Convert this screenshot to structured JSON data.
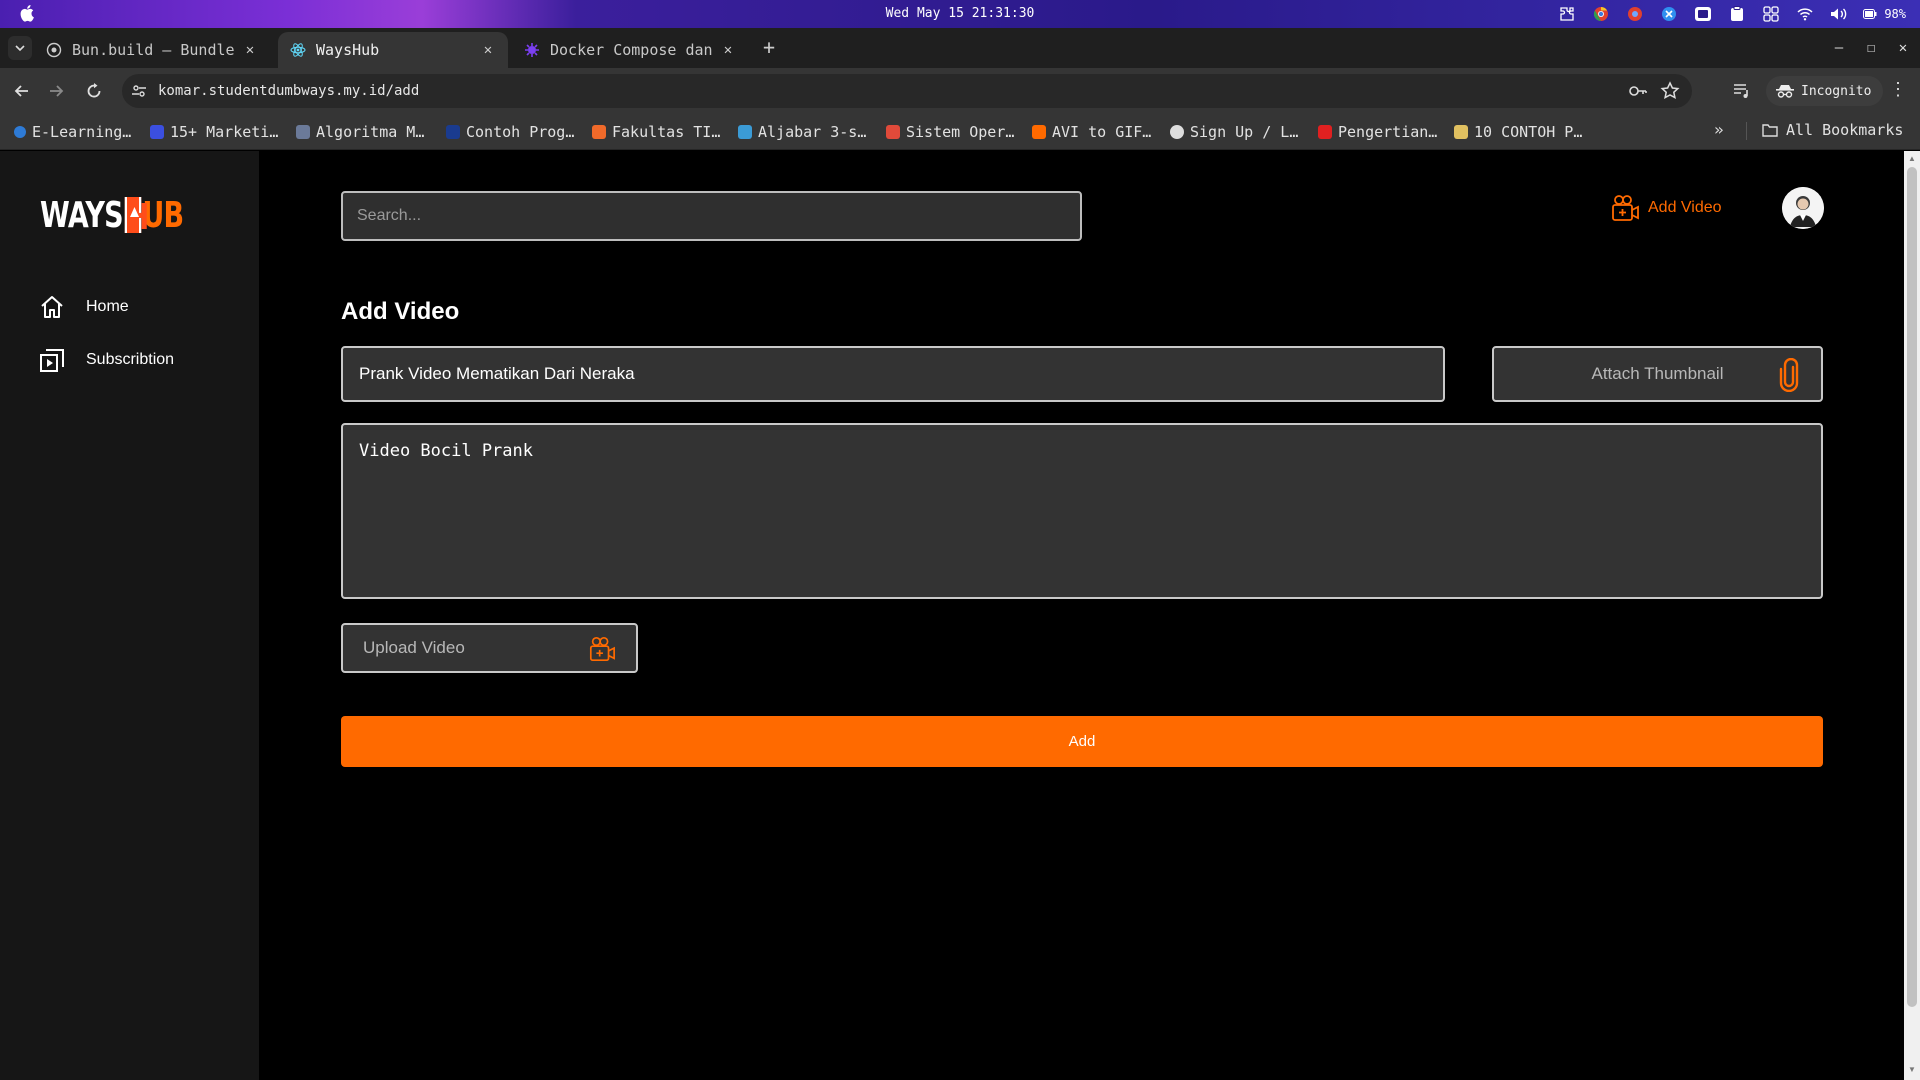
{
  "menubar": {
    "clock": "Wed May 15 21:31:30",
    "battery": "98%"
  },
  "tabs": [
    {
      "title": "Bun.build – Bundler",
      "active": false
    },
    {
      "title": "WaysHub",
      "active": true
    },
    {
      "title": "Docker Compose dan",
      "active": false
    }
  ],
  "toolbar": {
    "url": "komar.studentdumbways.my.id/add",
    "incognito_label": "Incognito"
  },
  "bookmarks": {
    "items": [
      {
        "label": "E-Learning…",
        "color": "#2e7bd6"
      },
      {
        "label": "15+ Marketi…",
        "color": "#3b4fe0"
      },
      {
        "label": "Algoritma M…",
        "color": "#6b7a99"
      },
      {
        "label": "Contoh Prog…",
        "color": "#1a3b8f"
      },
      {
        "label": "Fakultas TI…",
        "color": "#f06a2a"
      },
      {
        "label": "Aljabar 3-s…",
        "color": "#3b9bd6"
      },
      {
        "label": "Sistem Oper…",
        "color": "#e04a3a"
      },
      {
        "label": "AVI to GIF…",
        "color": "#ff6a00"
      },
      {
        "label": "Sign Up / L…",
        "color": "#dddddd"
      },
      {
        "label": "Pengertian…",
        "color": "#e02020"
      },
      {
        "label": "10 CONTOH P…",
        "color": "#e0c060"
      }
    ],
    "more": "»",
    "all_label": "All Bookmarks"
  },
  "sidebar": {
    "logo_left": "WAYS",
    "logo_right": "UB",
    "items": [
      {
        "label": "Home",
        "icon": "home-icon"
      },
      {
        "label": "Subscribtion",
        "icon": "subscription-icon"
      }
    ]
  },
  "header": {
    "search_placeholder": "Search...",
    "add_video_label": "Add Video"
  },
  "form": {
    "title": "Add Video",
    "video_title_value": "Prank Video Mematikan Dari Neraka",
    "thumbnail_label": "Attach Thumbnail",
    "description_value": "Video Bocil Prank",
    "upload_label": "Upload Video",
    "submit_label": "Add"
  },
  "colors": {
    "accent": "#ff6a00",
    "sidebar_bg": "#161616",
    "field_bg": "#333333"
  }
}
